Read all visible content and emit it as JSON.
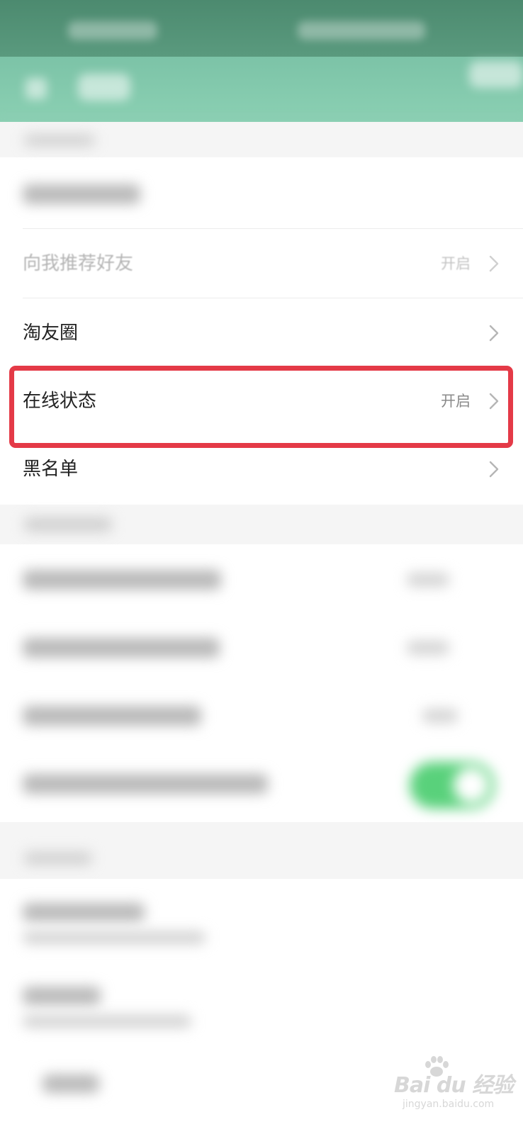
{
  "privacy_settings": {
    "rows": [
      {
        "label": "向我推荐好友",
        "value": "开启"
      },
      {
        "label": "淘友圈",
        "value": ""
      },
      {
        "label": "在线状态",
        "value": "开启"
      },
      {
        "label": "黑名单",
        "value": ""
      }
    ]
  },
  "watermark": {
    "brand": "Bai du 经验",
    "sub": "jingyan.baidu.com"
  },
  "colors": {
    "status_bar": "#4c8a6f",
    "header": "#7cc3a7",
    "highlight_border": "#e43a47",
    "toggle_on": "#59d17b",
    "value_text": "#8a8a8a"
  }
}
